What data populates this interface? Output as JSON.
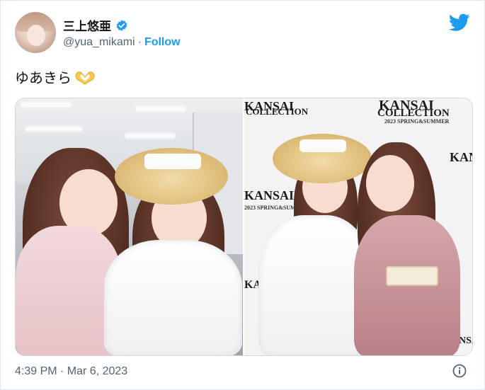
{
  "author": {
    "display_name": "三上悠亜",
    "handle": "@yua_mikami",
    "separator": "·",
    "follow_label": "Follow",
    "verified": true
  },
  "tweet": {
    "text": "ゆあきら",
    "emoji": "heart-hands-icon"
  },
  "media": {
    "photos": [
      {
        "label": "photo-left"
      },
      {
        "label": "photo-right",
        "backdrop_text": [
          "KANSAI",
          "COLLECTION",
          "2023 SPRING&SUMMER"
        ]
      }
    ]
  },
  "footer": {
    "timestamp": "4:39 PM · Mar 6, 2023"
  },
  "colors": {
    "accent": "#1d9bf0",
    "text_primary": "#0f1419",
    "text_secondary": "#536471",
    "border": "#cfd9de"
  }
}
